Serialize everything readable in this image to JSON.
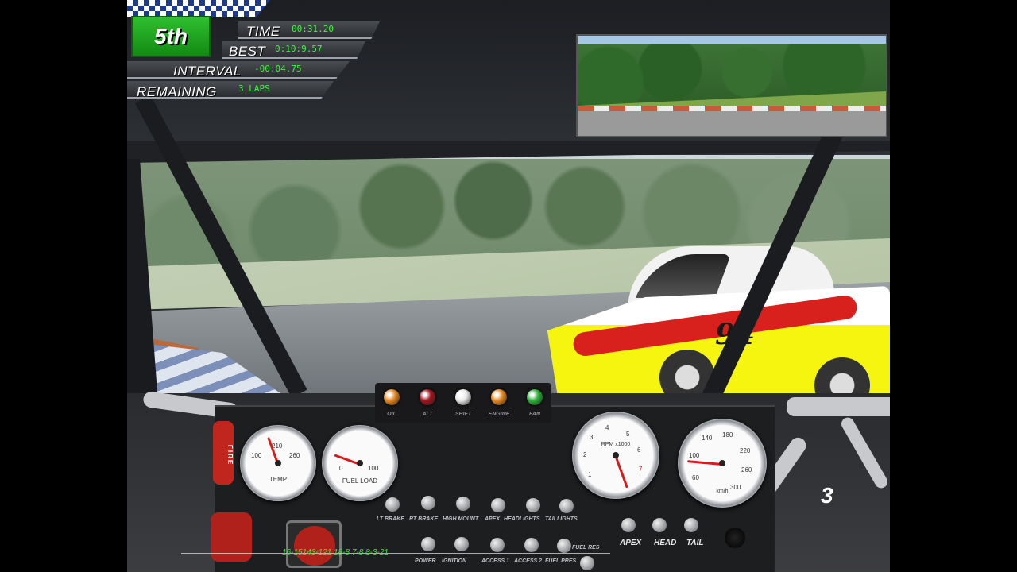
{
  "hud": {
    "position": "5th",
    "time_label": "TIME",
    "time_value": "00:31.20",
    "best_label": "BEST",
    "best_value": "0:10:9.57",
    "interval_label": "INTERVAL",
    "interval_value": "-00:04.75",
    "remaining_label": "REMAINING",
    "remaining_value": "3 LAPS"
  },
  "opponent_car": {
    "number": "94"
  },
  "warning_lights": [
    {
      "label": "OIL",
      "color": "#e88a22"
    },
    {
      "label": "ALT",
      "color": "#a0141c"
    },
    {
      "label": "SHIFT",
      "color": "#e8e8e8"
    },
    {
      "label": "ENGINE",
      "color": "#e88a22"
    },
    {
      "label": "FAN",
      "color": "#2fb23a"
    }
  ],
  "gauges": {
    "temp": {
      "label": "TEMP",
      "ticks": [
        "100",
        "210",
        "260"
      ],
      "reading": 210
    },
    "fuel": {
      "label": "FUEL LOAD",
      "ticks": [
        "0",
        "100"
      ],
      "reading_fraction": 0.5
    },
    "rpm": {
      "label": "RPM x1000",
      "ticks": [
        "1",
        "2",
        "3",
        "4",
        "5",
        "6",
        "7"
      ],
      "reading": 5.3
    },
    "speed": {
      "label": "km/h",
      "ticks": [
        "60",
        "100",
        "140",
        "180",
        "220",
        "260",
        "300"
      ],
      "reading": 60
    }
  },
  "switches_row1": [
    "LT BRAKE",
    "RT BRAKE",
    "HIGH MOUNT",
    "APEX",
    "HEADLIGHTS",
    "TAILLIGHTS"
  ],
  "switches_row2": [
    "POWER",
    "IGNITION",
    "ACCESS 1",
    "ACCESS 2",
    "FUEL PRES"
  ],
  "fuel_res_label": "FUEL RES",
  "right_switches": [
    "APEX",
    "HEAD",
    "TAIL"
  ],
  "fire_label": "FIRE",
  "gear": "3",
  "overlay_text": "16-15143-121     18-8  7-8  8-3-21",
  "colors": {
    "hud_green": "#3ff53f",
    "position_bg": "#1f9e1f",
    "needle": "#d81a1a"
  }
}
